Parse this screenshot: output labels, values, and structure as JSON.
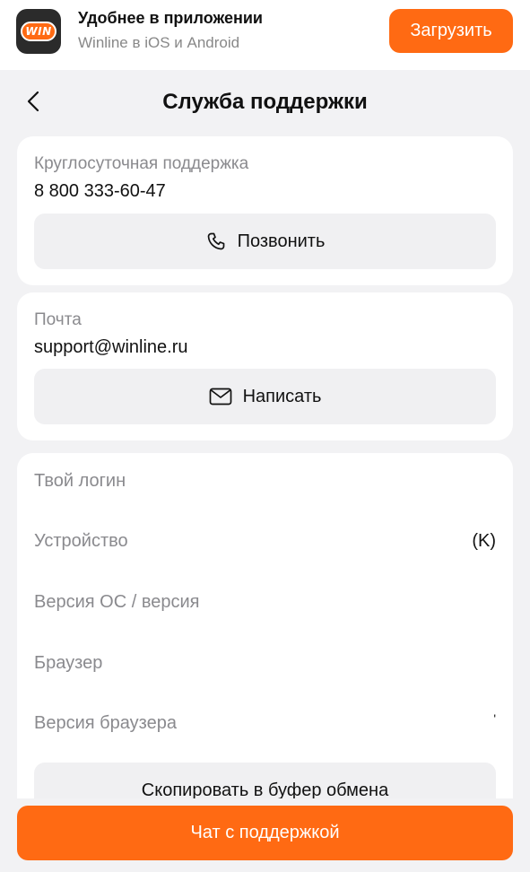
{
  "banner": {
    "logo_text": "WIN",
    "title": "Удобнее в приложении",
    "subtitle": "Winline в iOS и Android",
    "download_label": "Загрузить"
  },
  "header": {
    "title": "Служба поддержки"
  },
  "phone_card": {
    "label": "Круглосуточная поддержка",
    "value": "8 800 333-60-47",
    "button_label": "Позвонить"
  },
  "email_card": {
    "label": "Почта",
    "value": "support@winline.ru",
    "button_label": "Написать"
  },
  "info_card": {
    "rows": [
      {
        "label": "Твой логин",
        "value": ""
      },
      {
        "label": "Устройство",
        "value": "(K)"
      },
      {
        "label": "Версия ОС / версия",
        "value": ""
      },
      {
        "label": "Браузер",
        "value": ""
      },
      {
        "label": "Версия браузера",
        "value": "'"
      }
    ],
    "copy_label": "Скопировать в буфер обмена"
  },
  "chat_button_label": "Чат с поддержкой",
  "colors": {
    "accent": "#ff6a13",
    "background": "#f2f2f4",
    "muted_text": "#8a8a8e"
  }
}
